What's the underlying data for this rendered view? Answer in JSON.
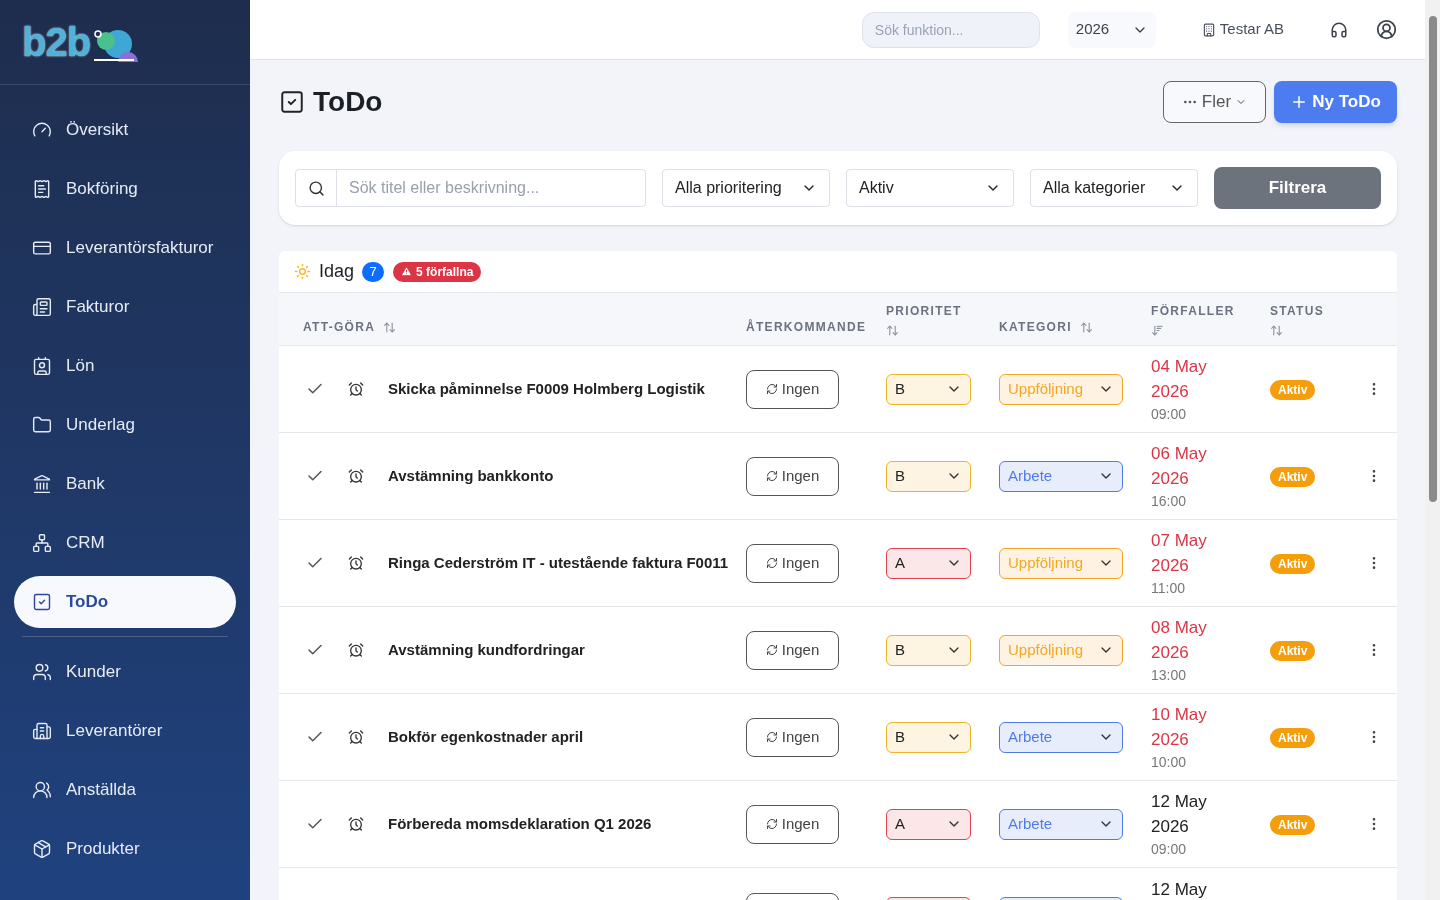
{
  "logo": "b2b",
  "sidebar": {
    "items": [
      {
        "label": "Översikt",
        "selected": false
      },
      {
        "label": "Bokföring",
        "selected": false
      },
      {
        "label": "Leverantörsfakturor",
        "selected": false
      },
      {
        "label": "Fakturor",
        "selected": false
      },
      {
        "label": "Lön",
        "selected": false
      },
      {
        "label": "Underlag",
        "selected": false
      },
      {
        "label": "Bank",
        "selected": false
      },
      {
        "label": "CRM",
        "selected": false
      },
      {
        "label": "ToDo",
        "selected": true
      },
      {
        "label": "Kunder",
        "selected": false
      },
      {
        "label": "Leverantörer",
        "selected": false
      },
      {
        "label": "Anställda",
        "selected": false
      },
      {
        "label": "Produkter",
        "selected": false
      }
    ]
  },
  "header": {
    "search_placeholder": "Sök funktion...",
    "year": "2026",
    "company": "Testar AB"
  },
  "page": {
    "title": "ToDo",
    "more_button": "Fler",
    "new_button": "Ny ToDo"
  },
  "filters": {
    "search_placeholder": "Sök titel eller beskrivning...",
    "selects": [
      "Alla prioritering",
      "Aktiv",
      "Alla kategorier"
    ],
    "button": "Filtrera"
  },
  "section": {
    "title": "Idag",
    "count": "7",
    "overdue_badge": "5 förfallna"
  },
  "table": {
    "columns": [
      "ATT-GÖRA",
      "ÅTERKOMMANDE",
      "PRIORITET",
      "KATEGORI",
      "FÖRFALLER",
      "STATUS"
    ],
    "rows": [
      {
        "kind": "full",
        "task": "Skicka påminnelse F0009 Holmberg Logistik",
        "recurring": "Ingen",
        "priority": {
          "label": "B",
          "color": "#f0b429"
        },
        "category": {
          "label": "Uppföljning",
          "color": "#f5a623"
        },
        "date": "04 May",
        "year": "2026",
        "time": "09:00",
        "overdue": true,
        "status": "Aktiv"
      },
      {
        "kind": "full",
        "task": "Avstämning bankkonto",
        "recurring": "Ingen",
        "priority": {
          "label": "B",
          "color": "#f0b429"
        },
        "category": {
          "label": "Arbete",
          "color": "#4f7be8"
        },
        "date": "06 May",
        "year": "2026",
        "time": "16:00",
        "overdue": true,
        "status": "Aktiv"
      },
      {
        "kind": "full",
        "task": "Ringa Cederström IT - utestående faktura F0011",
        "recurring": "Ingen",
        "priority": {
          "label": "A",
          "color": "#e0424f"
        },
        "category": {
          "label": "Uppföljning",
          "color": "#f5a623"
        },
        "date": "07 May",
        "year": "2026",
        "time": "11:00",
        "overdue": true,
        "status": "Aktiv"
      },
      {
        "kind": "full",
        "task": "Avstämning kundfordringar",
        "recurring": "Ingen",
        "priority": {
          "label": "B",
          "color": "#f0b429"
        },
        "category": {
          "label": "Uppföljning",
          "color": "#f5a623"
        },
        "date": "08 May",
        "year": "2026",
        "time": "13:00",
        "overdue": true,
        "status": "Aktiv"
      },
      {
        "kind": "full",
        "task": "Bokför egenkostnader april",
        "recurring": "Ingen",
        "priority": {
          "label": "B",
          "color": "#f0b429"
        },
        "category": {
          "label": "Arbete",
          "color": "#4f7be8"
        },
        "date": "10 May",
        "year": "2026",
        "time": "10:00",
        "overdue": true,
        "status": "Aktiv"
      },
      {
        "kind": "full",
        "task": "Förbereda momsdeklaration Q1 2026",
        "recurring": "Ingen",
        "priority": {
          "label": "A",
          "color": "#e0424f"
        },
        "category": {
          "label": "Arbete",
          "color": "#4f7be8"
        },
        "date": "12 May",
        "year": "2026",
        "time": "09:00",
        "overdue": false,
        "status": "Aktiv"
      },
      {
        "kind": "cut",
        "priority": {
          "color": "#e0424f"
        },
        "category": {
          "color": "#4f7be8"
        },
        "date": "12 May",
        "overdue": false
      }
    ]
  }
}
